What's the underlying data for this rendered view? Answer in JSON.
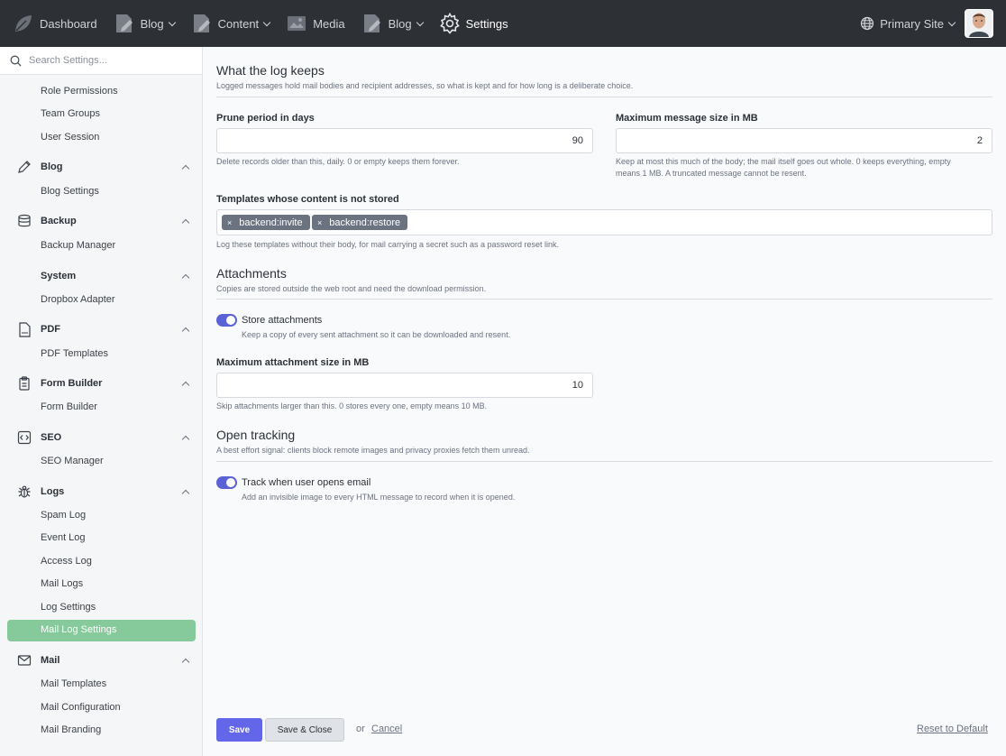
{
  "topnav": {
    "items": [
      {
        "label": "Dashboard",
        "icon": "leaf-logo-icon"
      },
      {
        "label": "Blog",
        "icon": "document-edit-icon"
      },
      {
        "label": "Content",
        "icon": "document-edit-icon"
      },
      {
        "label": "Media",
        "icon": "image-icon"
      },
      {
        "label": "Blog",
        "icon": "document-edit-icon"
      },
      {
        "label": "Settings",
        "icon": "gear-icon",
        "active": true
      }
    ],
    "site": "Primary Site"
  },
  "sidebar": {
    "search_placeholder": "Search Settings...",
    "top_items": [
      "Role Permissions",
      "Team Groups",
      "User Session"
    ],
    "groups": [
      {
        "name": "Blog",
        "icon": "pencil-icon",
        "items": [
          "Blog Settings"
        ]
      },
      {
        "name": "Backup",
        "icon": "database-icon",
        "items": [
          "Backup Manager"
        ]
      },
      {
        "name": "System",
        "icon": "",
        "items": [
          "Dropbox Adapter"
        ]
      },
      {
        "name": "PDF",
        "icon": "pdf-file-icon",
        "items": [
          "PDF Templates"
        ]
      },
      {
        "name": "Form Builder",
        "icon": "clipboard-icon",
        "items": [
          "Form Builder"
        ]
      },
      {
        "name": "SEO",
        "icon": "code-icon",
        "items": [
          "SEO Manager"
        ]
      },
      {
        "name": "Logs",
        "icon": "bug-icon",
        "items": [
          "Spam Log",
          "Event Log",
          "Access Log",
          "Mail Logs",
          "Log Settings",
          "Mail Log Settings"
        ]
      },
      {
        "name": "Mail",
        "icon": "envelope-icon",
        "items": [
          "Mail Templates",
          "Mail Configuration",
          "Mail Branding"
        ]
      }
    ],
    "active_item": "Mail Log Settings"
  },
  "main": {
    "keeps": {
      "title": "What the log keeps",
      "desc": "Logged messages hold mail bodies and recipient addresses, so what is kept and for how long is a deliberate choice.",
      "prune_label": "Prune period in days",
      "prune_value": "90",
      "prune_help": "Delete records older than this, daily. 0 or empty keeps them forever.",
      "maxsize_label": "Maximum message size in MB",
      "maxsize_value": "2",
      "maxsize_help_1": "Keep at most this much of the body; the mail itself goes out whole. 0 keeps everything, empty",
      "maxsize_help_2": "means 1 MB. A truncated message cannot be resent.",
      "templates_label": "Templates whose content is not stored",
      "tags": [
        "backend:invite",
        "backend:restore"
      ],
      "tag_remove": "×",
      "templates_help": "Log these templates without their body, for mail carrying a secret such as a password reset link."
    },
    "attachments": {
      "title": "Attachments",
      "desc": "Copies are stored outside the web root and need the download permission.",
      "store_label": "Store attachments",
      "store_desc": "Keep a copy of every sent attachment so it can be downloaded and resent.",
      "store_on": true,
      "maxatt_label": "Maximum attachment size in MB",
      "maxatt_value": "10",
      "maxatt_help": "Skip attachments larger than this. 0 stores every one, empty means 10 MB."
    },
    "tracking": {
      "title": "Open tracking",
      "desc": "A best effort signal: clients block remote images and privacy proxies fetch them unread.",
      "track_label": "Track when user opens email",
      "track_desc": "Add an invisible image to every HTML message to record when it is opened.",
      "track_on": true
    }
  },
  "footer": {
    "save": "Save",
    "save_close": "Save & Close",
    "or": "or",
    "cancel": "Cancel",
    "reset": "Reset to Default"
  },
  "colors": {
    "topbar": "#2d3035",
    "accent": "#6366e8",
    "active_item": "#86c99a"
  }
}
